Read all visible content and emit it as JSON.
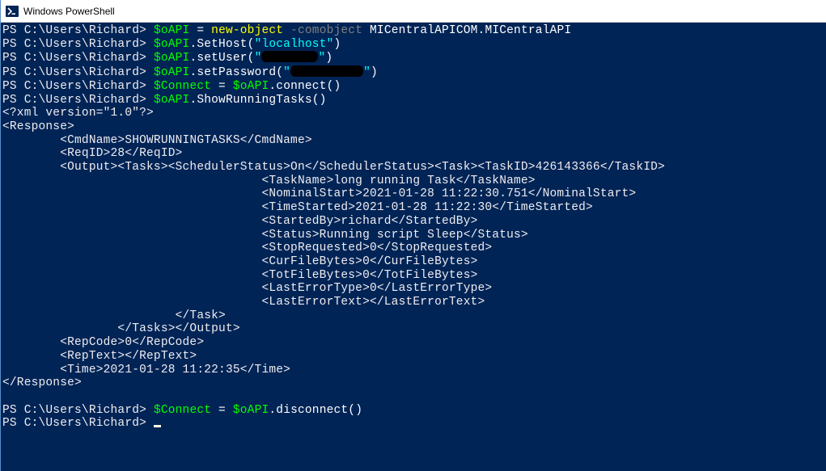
{
  "window": {
    "title": "Windows PowerShell"
  },
  "prompt": "PS C:\\Users\\Richard> ",
  "vars": {
    "oapi": "$oAPI",
    "connect": "$Connect"
  },
  "cmds": {
    "newobj": "new-object",
    "comobj": "-comobject",
    "comclass": "MICentralAPICOM.MICentralAPI",
    "sethost_pre": ".SetHost(",
    "sethost_arg": "\"localhost\"",
    "sethost_post": ")",
    "setuser_pre": ".setUser(",
    "setuser_q1": "\"",
    "setuser_q2": "\"",
    "setuser_post": ")",
    "setpass_pre": ".setPassword(",
    "setpass_q1": "\"",
    "setpass_q2": "\"",
    "setpass_post": ")",
    "connect_call": ".connect()",
    "showtasks": ".ShowRunningTasks()",
    "disconnect": ".disconnect()",
    "eq": " = "
  },
  "xml": {
    "decl": "<?xml version=\"1.0\"?>",
    "resp_open": "<Response>",
    "cmdname": "        <CmdName>SHOWRUNNINGTASKS</CmdName>",
    "reqid": "        <ReqID>28</ReqID>",
    "outhead": "        <Output><Tasks><SchedulerStatus>On</SchedulerStatus><Task><TaskID>426143366</TaskID>",
    "taskname": "                                    <TaskName>long running Task</TaskName>",
    "nominal": "                                    <NominalStart>2021-01-28 11:22:30.751</NominalStart>",
    "timestart": "                                    <TimeStarted>2021-01-28 11:22:30</TimeStarted>",
    "startedby": "                                    <StartedBy>richard</StartedBy>",
    "status": "                                    <Status>Running script Sleep</Status>",
    "stopreq": "                                    <StopRequested>0</StopRequested>",
    "curbytes": "                                    <CurFileBytes>0</CurFileBytes>",
    "totbytes": "                                    <TotFileBytes>0</TotFileBytes>",
    "lasterrt": "                                    <LastErrorType>0</LastErrorType>",
    "lasterrx": "                                    <LastErrorText></LastErrorText>",
    "taskclose": "                        </Task>",
    "tasksout": "                </Tasks></Output>",
    "repcode": "        <RepCode>0</RepCode>",
    "reptext": "        <RepText></RepText>",
    "time": "        <Time>2021-01-28 11:22:35</Time>",
    "resp_close": "</Response>"
  }
}
